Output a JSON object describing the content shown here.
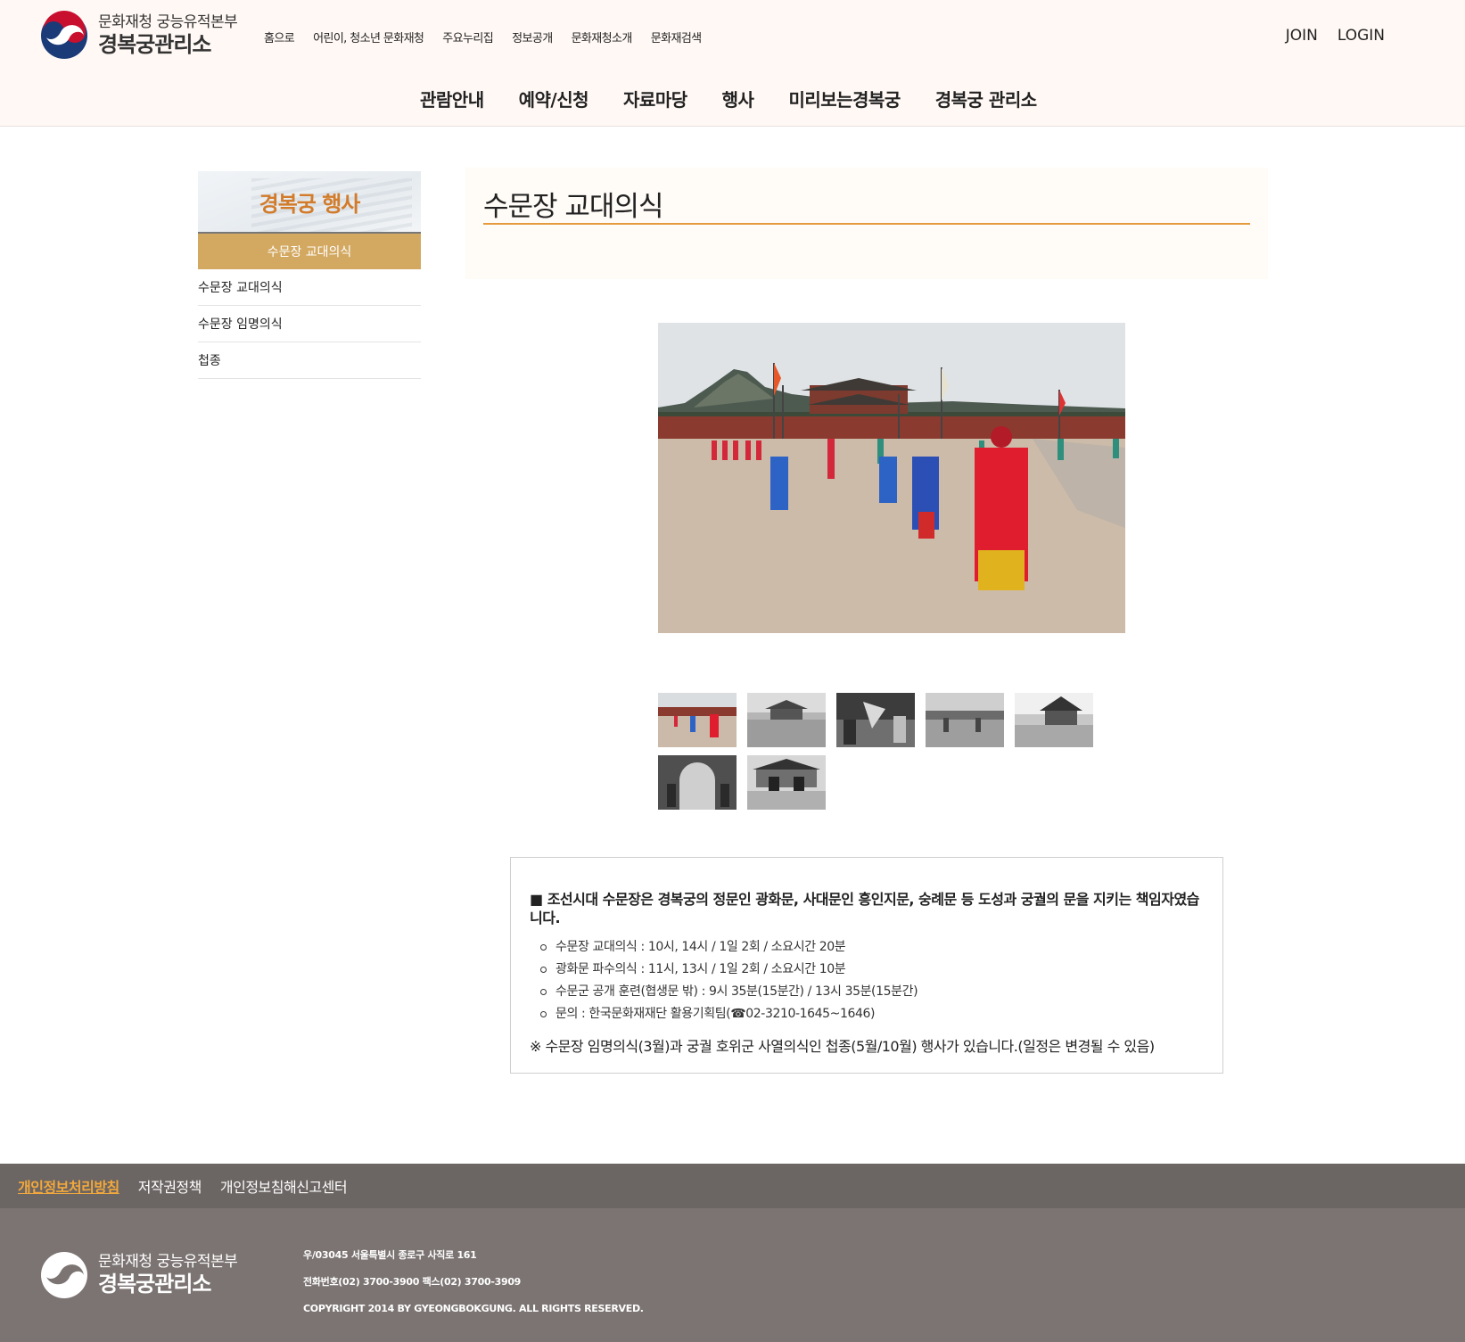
{
  "header": {
    "org_line1": "문화재청 궁능유적본부",
    "org_line2": "경복궁관리소",
    "top_links": [
      "홈으로",
      "어린이, 청소년 문화재청",
      "주요누리집",
      "정보공개",
      "문화재청소개",
      "문화재검색"
    ],
    "auth": {
      "join": "JOIN",
      "login": "LOGIN"
    },
    "gnb": [
      "관람안내",
      "예약/신청",
      "자료마당",
      "행사",
      "미리보는경복궁",
      "경복궁 관리소"
    ]
  },
  "sidebar": {
    "title": "경복궁 행사",
    "active": "수문장 교대의식",
    "items": [
      "수문장 교대의식",
      "수문장 임명의식",
      "첩종"
    ]
  },
  "content": {
    "title": "수문장 교대의식",
    "info": {
      "lead": "■ 조선시대 수문장은 경복궁의 정문인 광화문, 사대문인 흥인지문, 숭례문 등 도성과 궁궐의 문을 지키는 책임자였습니다.",
      "items": [
        "수문장 교대의식 : 10시, 14시 / 1일 2회 / 소요시간 20분",
        "광화문 파수의식 : 11시, 13시 / 1일 2회 / 소요시간 10분",
        "수문군 공개 훈련(협생문 밖) : 9시 35분(15분간) / 13시 35분(15분간)",
        "문의 : 한국문화재재단 활용기획팀(☎02-3210-1645~1646)"
      ],
      "note": "※ 수문장 임명의식(3월)과 궁궐 호위군 사열의식인 첩종(5월/10월) 행사가 있습니다.(일정은 변경될 수 있음)"
    }
  },
  "footer": {
    "links": [
      "개인정보처리방침",
      "저작권정책",
      "개인정보침해신고센터"
    ],
    "org_line1": "문화재청 궁능유적본부",
    "org_line2": "경복궁관리소",
    "address": "우/03045 서울특별시 종로구 사직로 161",
    "phone": "전화번호(02) 3700-3900 팩스(02) 3700-3909",
    "copyright": "COPYRIGHT 2014 BY GYEONGBOKGUNG. ALL RIGHTS RESERVED."
  },
  "colors": {
    "accent": "#d27b2a",
    "side_active": "#d3a860",
    "title_line": "#e39b3d",
    "footer_bar": "#6b6563",
    "footer_bg": "#7b7472",
    "footer_link_hl": "#f2a83c"
  }
}
